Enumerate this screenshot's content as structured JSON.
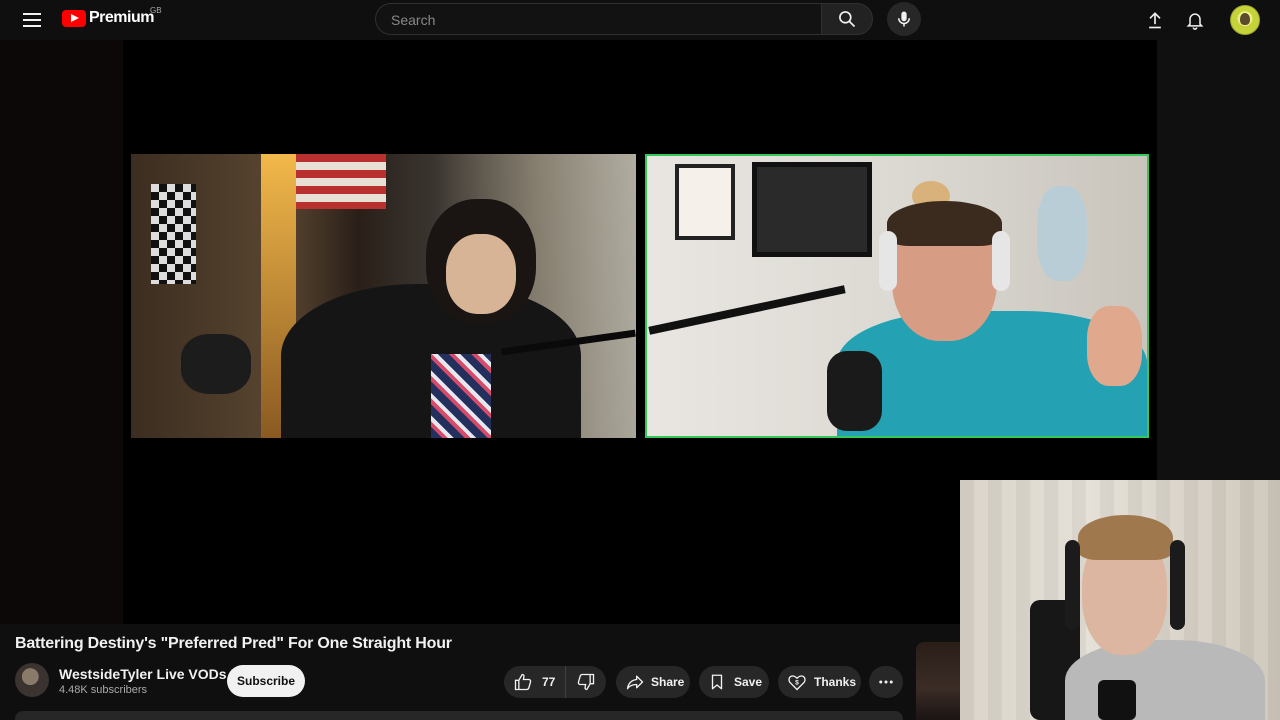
{
  "header": {
    "logo_text": "Premium",
    "region": "GB",
    "search_placeholder": "Search",
    "icons": [
      "menu-icon",
      "search-icon",
      "mic-icon",
      "upload-icon",
      "bell-icon",
      "avatar"
    ]
  },
  "video": {
    "title": "Battering Destiny's \"Preferred Pred\" For One Straight Hour"
  },
  "channel": {
    "name": "WestsideTyler Live VODs",
    "subscribers": "4.48K subscribers",
    "subscribe_label": "Subscribe"
  },
  "actions": {
    "like_count": "77",
    "share_label": "Share",
    "save_label": "Save",
    "thanks_label": "Thanks"
  },
  "colors": {
    "accent_red": "#ff0000",
    "active_speaker_border": "#34c759",
    "background": "#0f0f0f"
  }
}
